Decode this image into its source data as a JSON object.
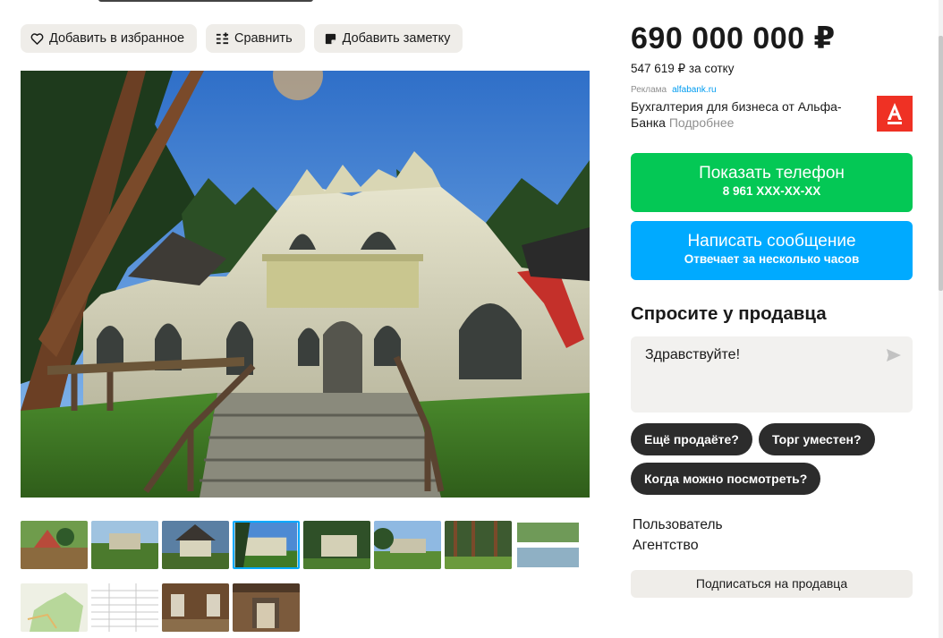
{
  "actions": {
    "favorite_label": "Добавить в избранное",
    "compare_label": "Сравнить",
    "note_label": "Добавить заметку"
  },
  "price": {
    "main": "690 000 000 ₽",
    "per_unit": "547 619 ₽ за сотку"
  },
  "ad": {
    "tag": "Реклама",
    "domain": "alfabank.ru",
    "text": "Бухгалтерия для бизнеса от Альфа-Банка",
    "more": "Подробнее",
    "logo_letter": "А",
    "logo_color": "#ef3124"
  },
  "phone_button": {
    "label": "Показать телефон",
    "number": "8 961 XXX-XX-XX",
    "color": "#04c855"
  },
  "message_button": {
    "label": "Написать сообщение",
    "sub": "Отвечает за несколько часов",
    "color": "#00aaff"
  },
  "ask": {
    "title": "Спросите у продавца",
    "input_value": "Здравствуйте!",
    "chips": [
      "Ещё продаёте?",
      "Торг уместен?",
      "Когда можно посмотреть?"
    ]
  },
  "seller": {
    "name": "Пользователь",
    "type": "Агентство",
    "subscribe_label": "Подписаться на продавца"
  },
  "gallery": {
    "selected_index": 3,
    "thumb_count": 12
  }
}
